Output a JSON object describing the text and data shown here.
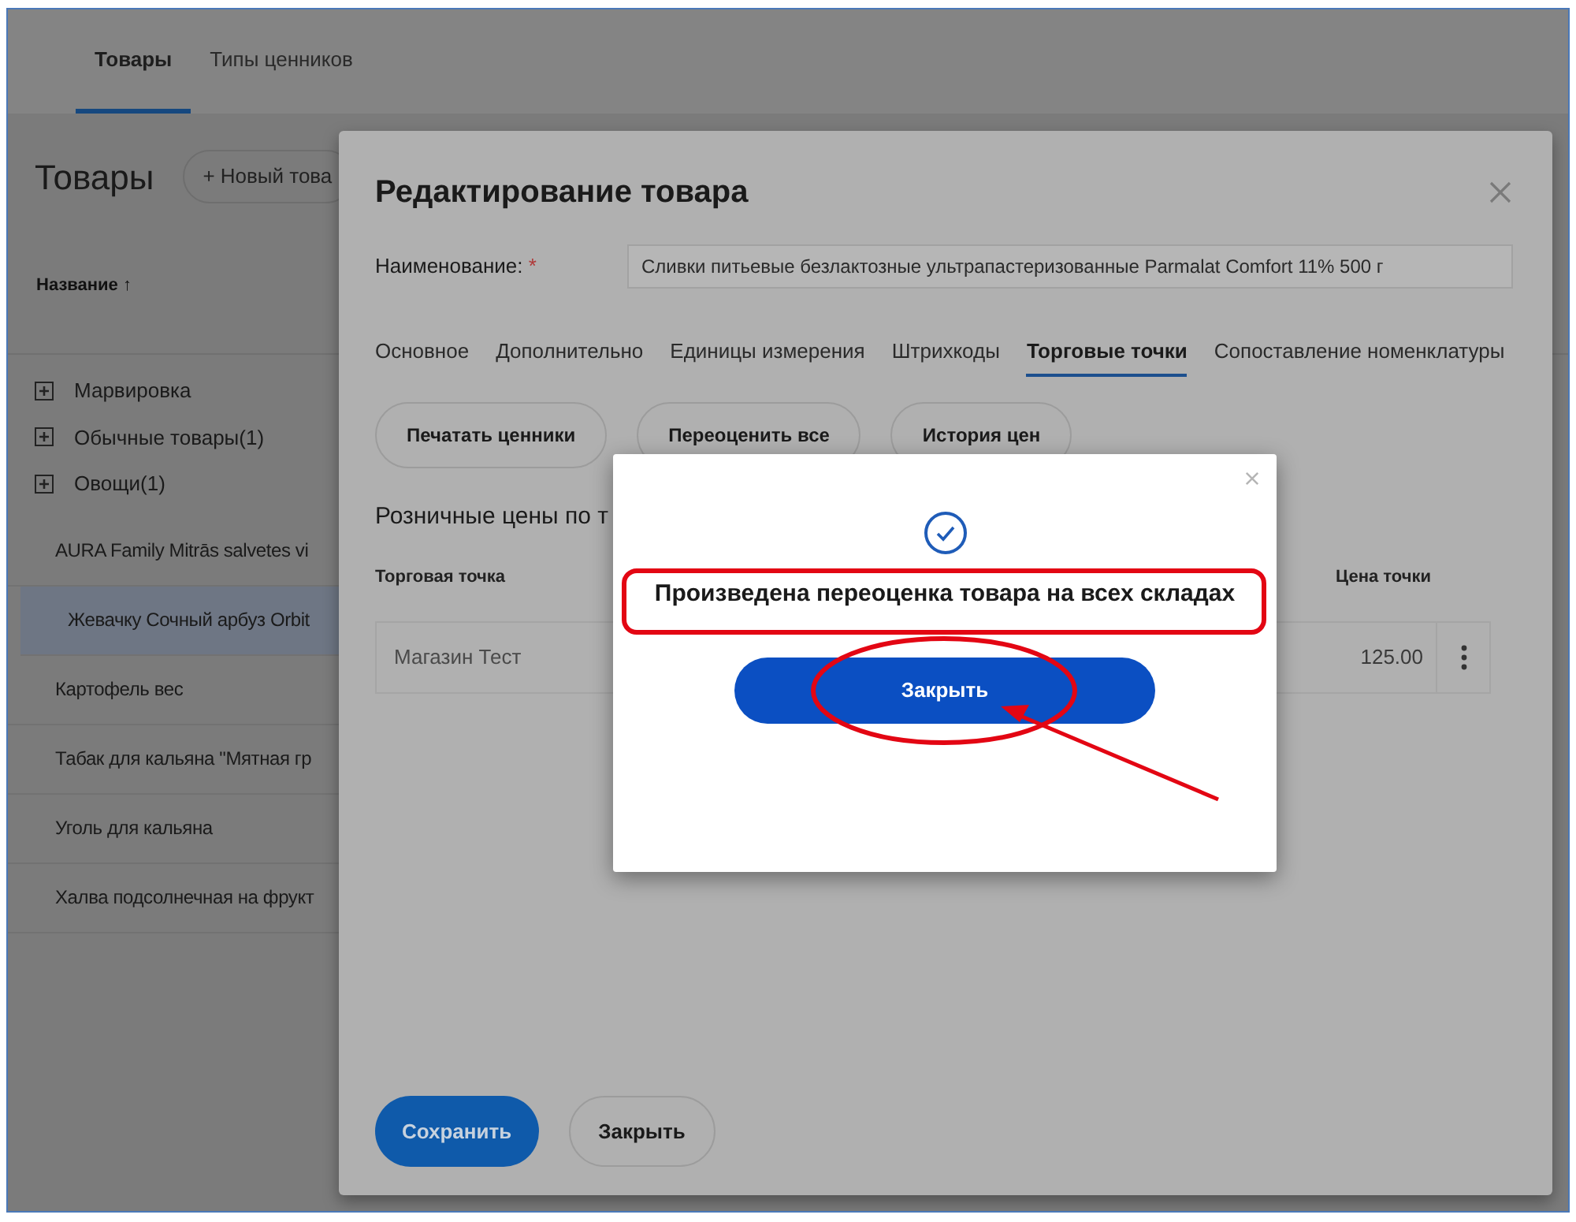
{
  "top_tabs": [
    {
      "label": "Товары",
      "selected": true
    },
    {
      "label": "Типы ценников",
      "selected": false
    }
  ],
  "products_panel": {
    "title": "Товары",
    "new_button": "+ Новый това",
    "column_header": "Название ↑",
    "groups": [
      {
        "label": "Марвировка",
        "expanded": false
      },
      {
        "label": "Обычные товары(1)",
        "expanded": false
      },
      {
        "label": "Овощи(1)",
        "expanded": false
      }
    ],
    "items": [
      {
        "label": "AURA Family Mitrās salvetes vi",
        "selected": false
      },
      {
        "label": "Жевачку Сочный арбуз Orbit",
        "selected": true
      },
      {
        "label": "Картофель вес",
        "selected": false
      },
      {
        "label": "Табак для кальяна \"Мятная гр",
        "selected": false
      },
      {
        "label": "Уголь для кальяна",
        "selected": false
      },
      {
        "label": "Халва подсолнечная на фрукт",
        "selected": false
      }
    ]
  },
  "edit_drawer": {
    "title": "Редактирование товара",
    "name_label": "Наименование:",
    "required_mark": "*",
    "name_value": "Сливки питьевые безлактозные ультрапастеризованные Parmalat Comfort 11% 500 г",
    "tabs": [
      {
        "label": "Основное",
        "selected": false
      },
      {
        "label": "Дополнительно",
        "selected": false
      },
      {
        "label": "Единицы измерения",
        "selected": false
      },
      {
        "label": "Штрихкоды",
        "selected": false
      },
      {
        "label": "Торговые точки",
        "selected": true
      },
      {
        "label": "Сопоставление номенклатуры",
        "selected": false
      }
    ],
    "actions": [
      "Печатать ценники",
      "Переоценить все",
      "История цен"
    ],
    "section_title": "Розничные цены по т",
    "columns": [
      "Торговая точка",
      "Цена точки"
    ],
    "rows": [
      {
        "store": "Магазин Тест",
        "price": "125.00"
      }
    ],
    "footer_buttons": [
      {
        "label": "Сохранить",
        "kind": "primary"
      },
      {
        "label": "Закрыть",
        "kind": "secondary"
      }
    ]
  },
  "dialog": {
    "message": "Произведена переоценка товара на всех складах",
    "button": "Закрыть"
  }
}
